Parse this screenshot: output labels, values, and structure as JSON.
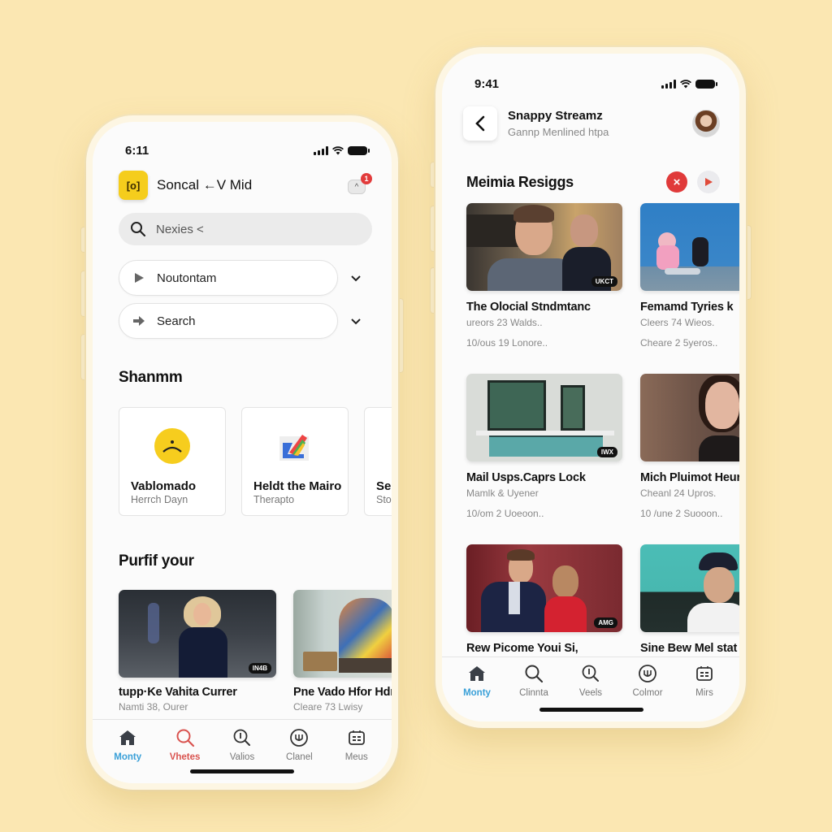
{
  "background_color": "#fbe7b2",
  "left_phone": {
    "status": {
      "time": "6:11"
    },
    "header": {
      "logo_text": "[o]",
      "title": "Soncal ←V Mid",
      "notification_count": "1"
    },
    "search": {
      "value": "Nexies <",
      "placeholder": "Search"
    },
    "dropdowns": [
      {
        "label": "Noutontam",
        "icon": "play-icon"
      },
      {
        "label": "Search",
        "icon": "arrow-right-icon"
      }
    ],
    "section1_title": "Shanmm",
    "categories": [
      {
        "title": "Vablomado",
        "subtitle": "Herrch Dayn",
        "icon": "sad-face-icon"
      },
      {
        "title": "Heldt the Mairo",
        "subtitle": "Therapto",
        "icon": "colorful-logo-icon"
      },
      {
        "title": "Se",
        "subtitle": "Sto",
        "icon": ""
      }
    ],
    "section2_title": "Purfif your",
    "videos": [
      {
        "title": "tupp·Ke Vahita Currer",
        "subtitle": "Namti 38, Ourer",
        "duration": "IN4B"
      },
      {
        "title": "Pne Vado Hfor Hdr",
        "subtitle": "Cleare 73 Lwisy",
        "duration": ""
      }
    ],
    "tabs": [
      {
        "label": "Monty",
        "icon": "home-icon",
        "color": "#3aa0d8"
      },
      {
        "label": "Vhetes",
        "icon": "search-icon",
        "color": "#d9534f"
      },
      {
        "label": "Valios",
        "icon": "info-search-icon",
        "color": "#777777"
      },
      {
        "label": "Clanel",
        "icon": "channel-icon",
        "color": "#777777"
      },
      {
        "label": "Meus",
        "icon": "menu-calendar-icon",
        "color": "#777777"
      }
    ]
  },
  "right_phone": {
    "status": {
      "time": "9:41"
    },
    "header": {
      "back_label": "<",
      "title": "Snappy Streamz",
      "subtitle": "Gannp Menlined htpa"
    },
    "section_title": "Meimia Resiggs",
    "section_actions": {
      "close_label": "×"
    },
    "videos": [
      {
        "title": "The Olocial Stndmtanc",
        "line1": "ureors 23 Walds..",
        "line2": "10/ous 19 Lonore..",
        "duration": "UKCT"
      },
      {
        "title": "Femamd Tyries k",
        "line1": "Cleers 74 Wieos.",
        "line2": "Cheare 2 5yeros..",
        "duration": ""
      },
      {
        "title": "Mail Usps.Caprs Lock",
        "line1": "Mamlk & Uyener",
        "line2": "10/om 2 Uoeoon..",
        "duration": "IWX"
      },
      {
        "title": "Mich Pluimot Heur",
        "line1": "Cheanl 24 Upros.",
        "line2": "10 /une 2 Suooon..",
        "duration": ""
      },
      {
        "title": "Rew Picome Youi Si,",
        "line1": "",
        "line2": "",
        "duration": "AMG"
      },
      {
        "title": "Sine Bew Mel stat",
        "line1": "",
        "line2": "",
        "duration": ""
      }
    ],
    "tabs": [
      {
        "label": "Monty",
        "icon": "home-icon",
        "color": "#3aa0d8"
      },
      {
        "label": "Clinnta",
        "icon": "search-icon",
        "color": "#777777"
      },
      {
        "label": "Veels",
        "icon": "info-search-icon",
        "color": "#777777"
      },
      {
        "label": "Colmor",
        "icon": "channel-icon",
        "color": "#777777"
      },
      {
        "label": "Mirs",
        "icon": "menu-calendar-icon",
        "color": "#777777"
      }
    ]
  }
}
